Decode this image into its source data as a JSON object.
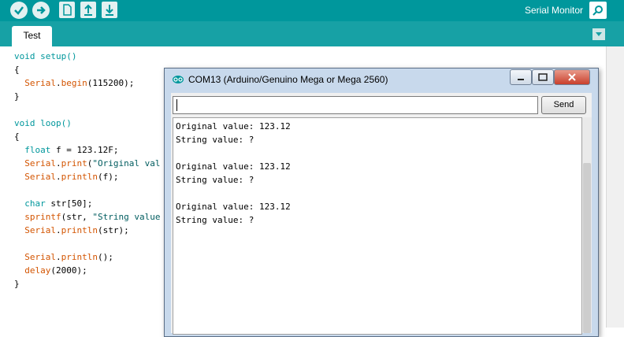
{
  "toolbar": {
    "serial_monitor_label": "Serial Monitor",
    "accent": "#00979c"
  },
  "tabs": [
    {
      "label": "Test"
    }
  ],
  "code_lines": [
    [
      {
        "t": "void setup()",
        "c": "kw"
      }
    ],
    [
      {
        "t": "{",
        "c": ""
      }
    ],
    [
      {
        "t": "  ",
        "c": ""
      },
      {
        "t": "Serial",
        "c": "fn"
      },
      {
        "t": ".",
        "c": ""
      },
      {
        "t": "begin",
        "c": "fn"
      },
      {
        "t": "(115200);",
        "c": ""
      }
    ],
    [
      {
        "t": "}",
        "c": ""
      }
    ],
    [
      {
        "t": "",
        "c": ""
      }
    ],
    [
      {
        "t": "void loop()",
        "c": "kw"
      }
    ],
    [
      {
        "t": "{",
        "c": ""
      }
    ],
    [
      {
        "t": "  ",
        "c": ""
      },
      {
        "t": "float",
        "c": "kw"
      },
      {
        "t": " f = 123.12F;",
        "c": ""
      }
    ],
    [
      {
        "t": "  ",
        "c": ""
      },
      {
        "t": "Serial",
        "c": "fn"
      },
      {
        "t": ".",
        "c": ""
      },
      {
        "t": "print",
        "c": "fn"
      },
      {
        "t": "(",
        "c": ""
      },
      {
        "t": "\"Original val",
        "c": "str"
      }
    ],
    [
      {
        "t": "  ",
        "c": ""
      },
      {
        "t": "Serial",
        "c": "fn"
      },
      {
        "t": ".",
        "c": ""
      },
      {
        "t": "println",
        "c": "fn"
      },
      {
        "t": "(f);",
        "c": ""
      }
    ],
    [
      {
        "t": "",
        "c": ""
      }
    ],
    [
      {
        "t": "  ",
        "c": ""
      },
      {
        "t": "char",
        "c": "kw"
      },
      {
        "t": " str[50];",
        "c": ""
      }
    ],
    [
      {
        "t": "  ",
        "c": ""
      },
      {
        "t": "sprintf",
        "c": "fn"
      },
      {
        "t": "(str, ",
        "c": ""
      },
      {
        "t": "\"String value",
        "c": "str"
      }
    ],
    [
      {
        "t": "  ",
        "c": ""
      },
      {
        "t": "Serial",
        "c": "fn"
      },
      {
        "t": ".",
        "c": ""
      },
      {
        "t": "println",
        "c": "fn"
      },
      {
        "t": "(str);",
        "c": ""
      }
    ],
    [
      {
        "t": "",
        "c": ""
      }
    ],
    [
      {
        "t": "  ",
        "c": ""
      },
      {
        "t": "Serial",
        "c": "fn"
      },
      {
        "t": ".",
        "c": ""
      },
      {
        "t": "println",
        "c": "fn"
      },
      {
        "t": "();",
        "c": ""
      }
    ],
    [
      {
        "t": "  ",
        "c": ""
      },
      {
        "t": "delay",
        "c": "fn"
      },
      {
        "t": "(2000);",
        "c": ""
      }
    ],
    [
      {
        "t": "}",
        "c": ""
      }
    ]
  ],
  "serial_window": {
    "title": "COM13 (Arduino/Genuino Mega or Mega 2560)",
    "input_value": "",
    "send_label": "Send",
    "output_lines": [
      "Original value: 123.12",
      "String value: ?",
      "",
      "Original value: 123.12",
      "String value: ?",
      "",
      "Original value: 123.12",
      "String value: ?"
    ]
  }
}
